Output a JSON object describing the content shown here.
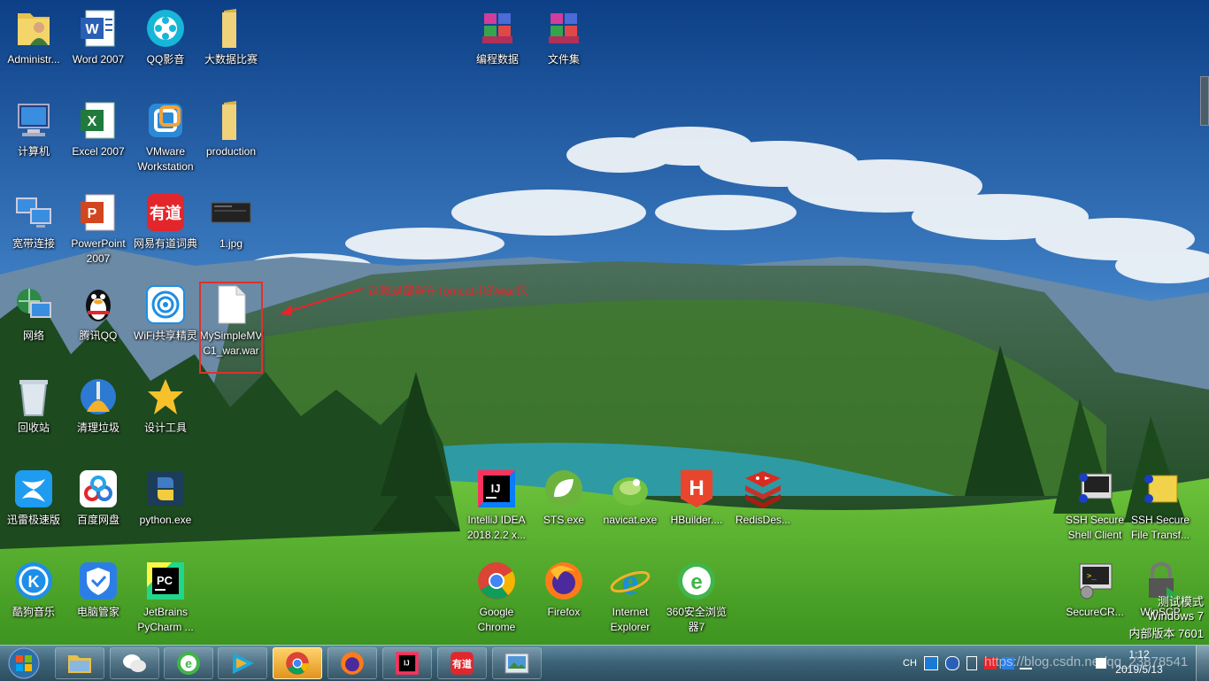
{
  "desktop": {
    "icons": [
      {
        "id": "administrator",
        "label": "Administr...",
        "icon": "user-folder-icon"
      },
      {
        "id": "word2007",
        "label": "Word 2007",
        "icon": "word-icon"
      },
      {
        "id": "qqplayer",
        "label": "QQ影音",
        "icon": "qq-player-icon"
      },
      {
        "id": "bigdata",
        "label": "大数据比赛",
        "icon": "folder-icon"
      },
      {
        "id": "computer",
        "label": "计算机",
        "icon": "computer-icon"
      },
      {
        "id": "excel2007",
        "label": "Excel 2007",
        "icon": "excel-icon"
      },
      {
        "id": "vmware",
        "label": "VMware Workstation",
        "icon": "vmware-icon"
      },
      {
        "id": "production",
        "label": "production",
        "icon": "folder-icon"
      },
      {
        "id": "broadband",
        "label": "宽带连接",
        "icon": "network-computers-icon"
      },
      {
        "id": "powerpoint",
        "label": "PowerPoint 2007",
        "icon": "powerpoint-icon"
      },
      {
        "id": "youdao",
        "label": "网易有道词典",
        "icon": "youdao-icon"
      },
      {
        "id": "jpg",
        "label": "1.jpg",
        "icon": "image-thumbnail-icon"
      },
      {
        "id": "network",
        "label": "网络",
        "icon": "network-globe-icon"
      },
      {
        "id": "qq",
        "label": "腾讯QQ",
        "icon": "qq-penguin-icon"
      },
      {
        "id": "wifi",
        "label": "WiFi共享精灵",
        "icon": "wifi-icon"
      },
      {
        "id": "war",
        "label": "MySimpleMVC1_war.war",
        "icon": "file-icon"
      },
      {
        "id": "recycle",
        "label": "回收站",
        "icon": "recycle-bin-icon"
      },
      {
        "id": "cleaner",
        "label": "清理垃圾",
        "icon": "broom-icon"
      },
      {
        "id": "designtool",
        "label": "设计工具",
        "icon": "star-icon"
      },
      {
        "id": "xunlei",
        "label": "迅雷极速版",
        "icon": "xunlei-icon"
      },
      {
        "id": "baidupan",
        "label": "百度网盘",
        "icon": "baidu-cloud-icon"
      },
      {
        "id": "python",
        "label": "python.exe",
        "icon": "python-icon"
      },
      {
        "id": "kugou",
        "label": "酷狗音乐",
        "icon": "kugou-icon"
      },
      {
        "id": "guanjia",
        "label": "电脑管家",
        "icon": "shield-icon"
      },
      {
        "id": "pycharm",
        "label": "JetBrains PyCharm ...",
        "icon": "pycharm-icon"
      },
      {
        "id": "biancheng",
        "label": "编程数据",
        "icon": "winrar-icon"
      },
      {
        "id": "wenjianji",
        "label": "文件集",
        "icon": "winrar-icon"
      },
      {
        "id": "idea",
        "label": "IntelliJ IDEA 2018.2.2 x...",
        "icon": "intellij-icon"
      },
      {
        "id": "sts",
        "label": "STS.exe",
        "icon": "sts-leaf-icon"
      },
      {
        "id": "navicat",
        "label": "navicat.exe",
        "icon": "navicat-icon"
      },
      {
        "id": "hbuilder",
        "label": "HBuilder....",
        "icon": "hbuilder-icon"
      },
      {
        "id": "redis",
        "label": "RedisDes...",
        "icon": "redis-icon"
      },
      {
        "id": "chrome",
        "label": "Google Chrome",
        "icon": "chrome-icon"
      },
      {
        "id": "firefox",
        "label": "Firefox",
        "icon": "firefox-icon"
      },
      {
        "id": "ie",
        "label": "Internet Explorer",
        "icon": "ie-icon"
      },
      {
        "id": "360",
        "label": "360安全浏览器7",
        "icon": "browser-360-icon"
      },
      {
        "id": "sshclient",
        "label": "SSH Secure Shell Client",
        "icon": "ssh-client-icon"
      },
      {
        "id": "sshtransfer",
        "label": "SSH Secure File Transf...",
        "icon": "ssh-transfer-icon"
      },
      {
        "id": "securecrt",
        "label": "SecureCR...",
        "icon": "securecrt-icon"
      },
      {
        "id": "winscp",
        "label": "WinSCP",
        "icon": "winscp-icon"
      }
    ],
    "annotation": "这就是部署在Tomcat中的war包"
  },
  "taskbar": {
    "start": "windows-start-icon",
    "pinned": [
      {
        "id": "explorer",
        "icon": "explorer-icon"
      },
      {
        "id": "wechat",
        "icon": "wechat-icon"
      },
      {
        "id": "360browser",
        "icon": "browser-360-icon"
      },
      {
        "id": "media",
        "icon": "media-player-icon"
      },
      {
        "id": "chrome",
        "icon": "chrome-icon",
        "active": true
      },
      {
        "id": "firefox",
        "icon": "firefox-icon"
      },
      {
        "id": "idea",
        "icon": "intellij-icon"
      },
      {
        "id": "youdao",
        "icon": "youdao-icon"
      },
      {
        "id": "photo",
        "icon": "photo-viewer-icon"
      }
    ],
    "tray": {
      "lang": "CH",
      "time": "1:12",
      "date": "2019/5/13"
    }
  },
  "watermark": {
    "line1": "测试模式",
    "line2": "Windows 7",
    "line3": "内部版本 7601",
    "url": "https://blog.csdn.net/qq_23878541"
  },
  "colors": {
    "annotation": "#e8242a",
    "selection": "#e0312b"
  }
}
